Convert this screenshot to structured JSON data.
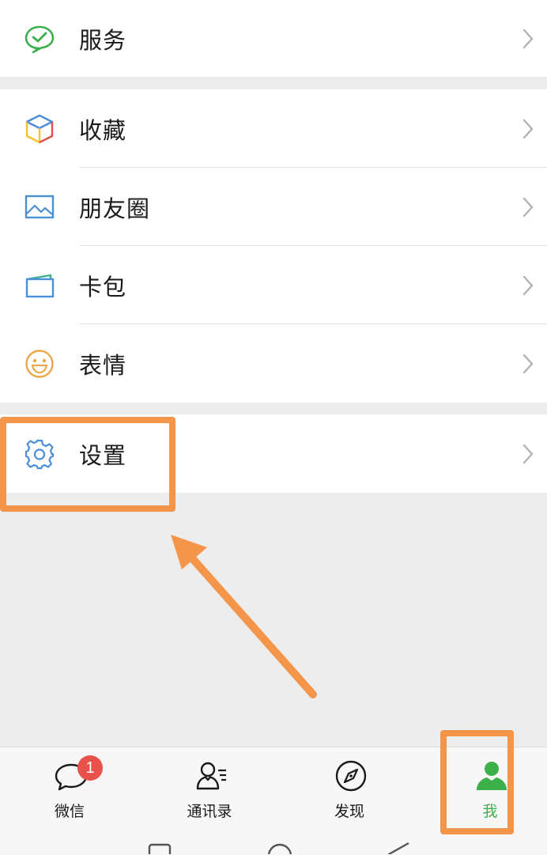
{
  "menu": {
    "services": {
      "label": "服务",
      "icon": "wechat-pay-check-icon"
    },
    "favorites": {
      "label": "收藏",
      "icon": "cube-icon"
    },
    "moments": {
      "label": "朋友圈",
      "icon": "picture-icon"
    },
    "cards": {
      "label": "卡包",
      "icon": "card-wallet-icon"
    },
    "stickers": {
      "label": "表情",
      "icon": "smiley-icon"
    },
    "settings": {
      "label": "设置",
      "icon": "gear-icon"
    }
  },
  "bottom_nav": {
    "tabs": [
      {
        "label": "微信",
        "icon": "chat-bubble-icon",
        "badge": "1"
      },
      {
        "label": "通讯录",
        "icon": "contacts-icon"
      },
      {
        "label": "发现",
        "icon": "compass-icon"
      },
      {
        "label": "我",
        "icon": "person-icon",
        "active": true
      }
    ]
  },
  "colors": {
    "accent_green": "#3cb04b",
    "highlight_orange": "#f5954a",
    "badge_red": "#e9524a",
    "background": "#ededed"
  }
}
